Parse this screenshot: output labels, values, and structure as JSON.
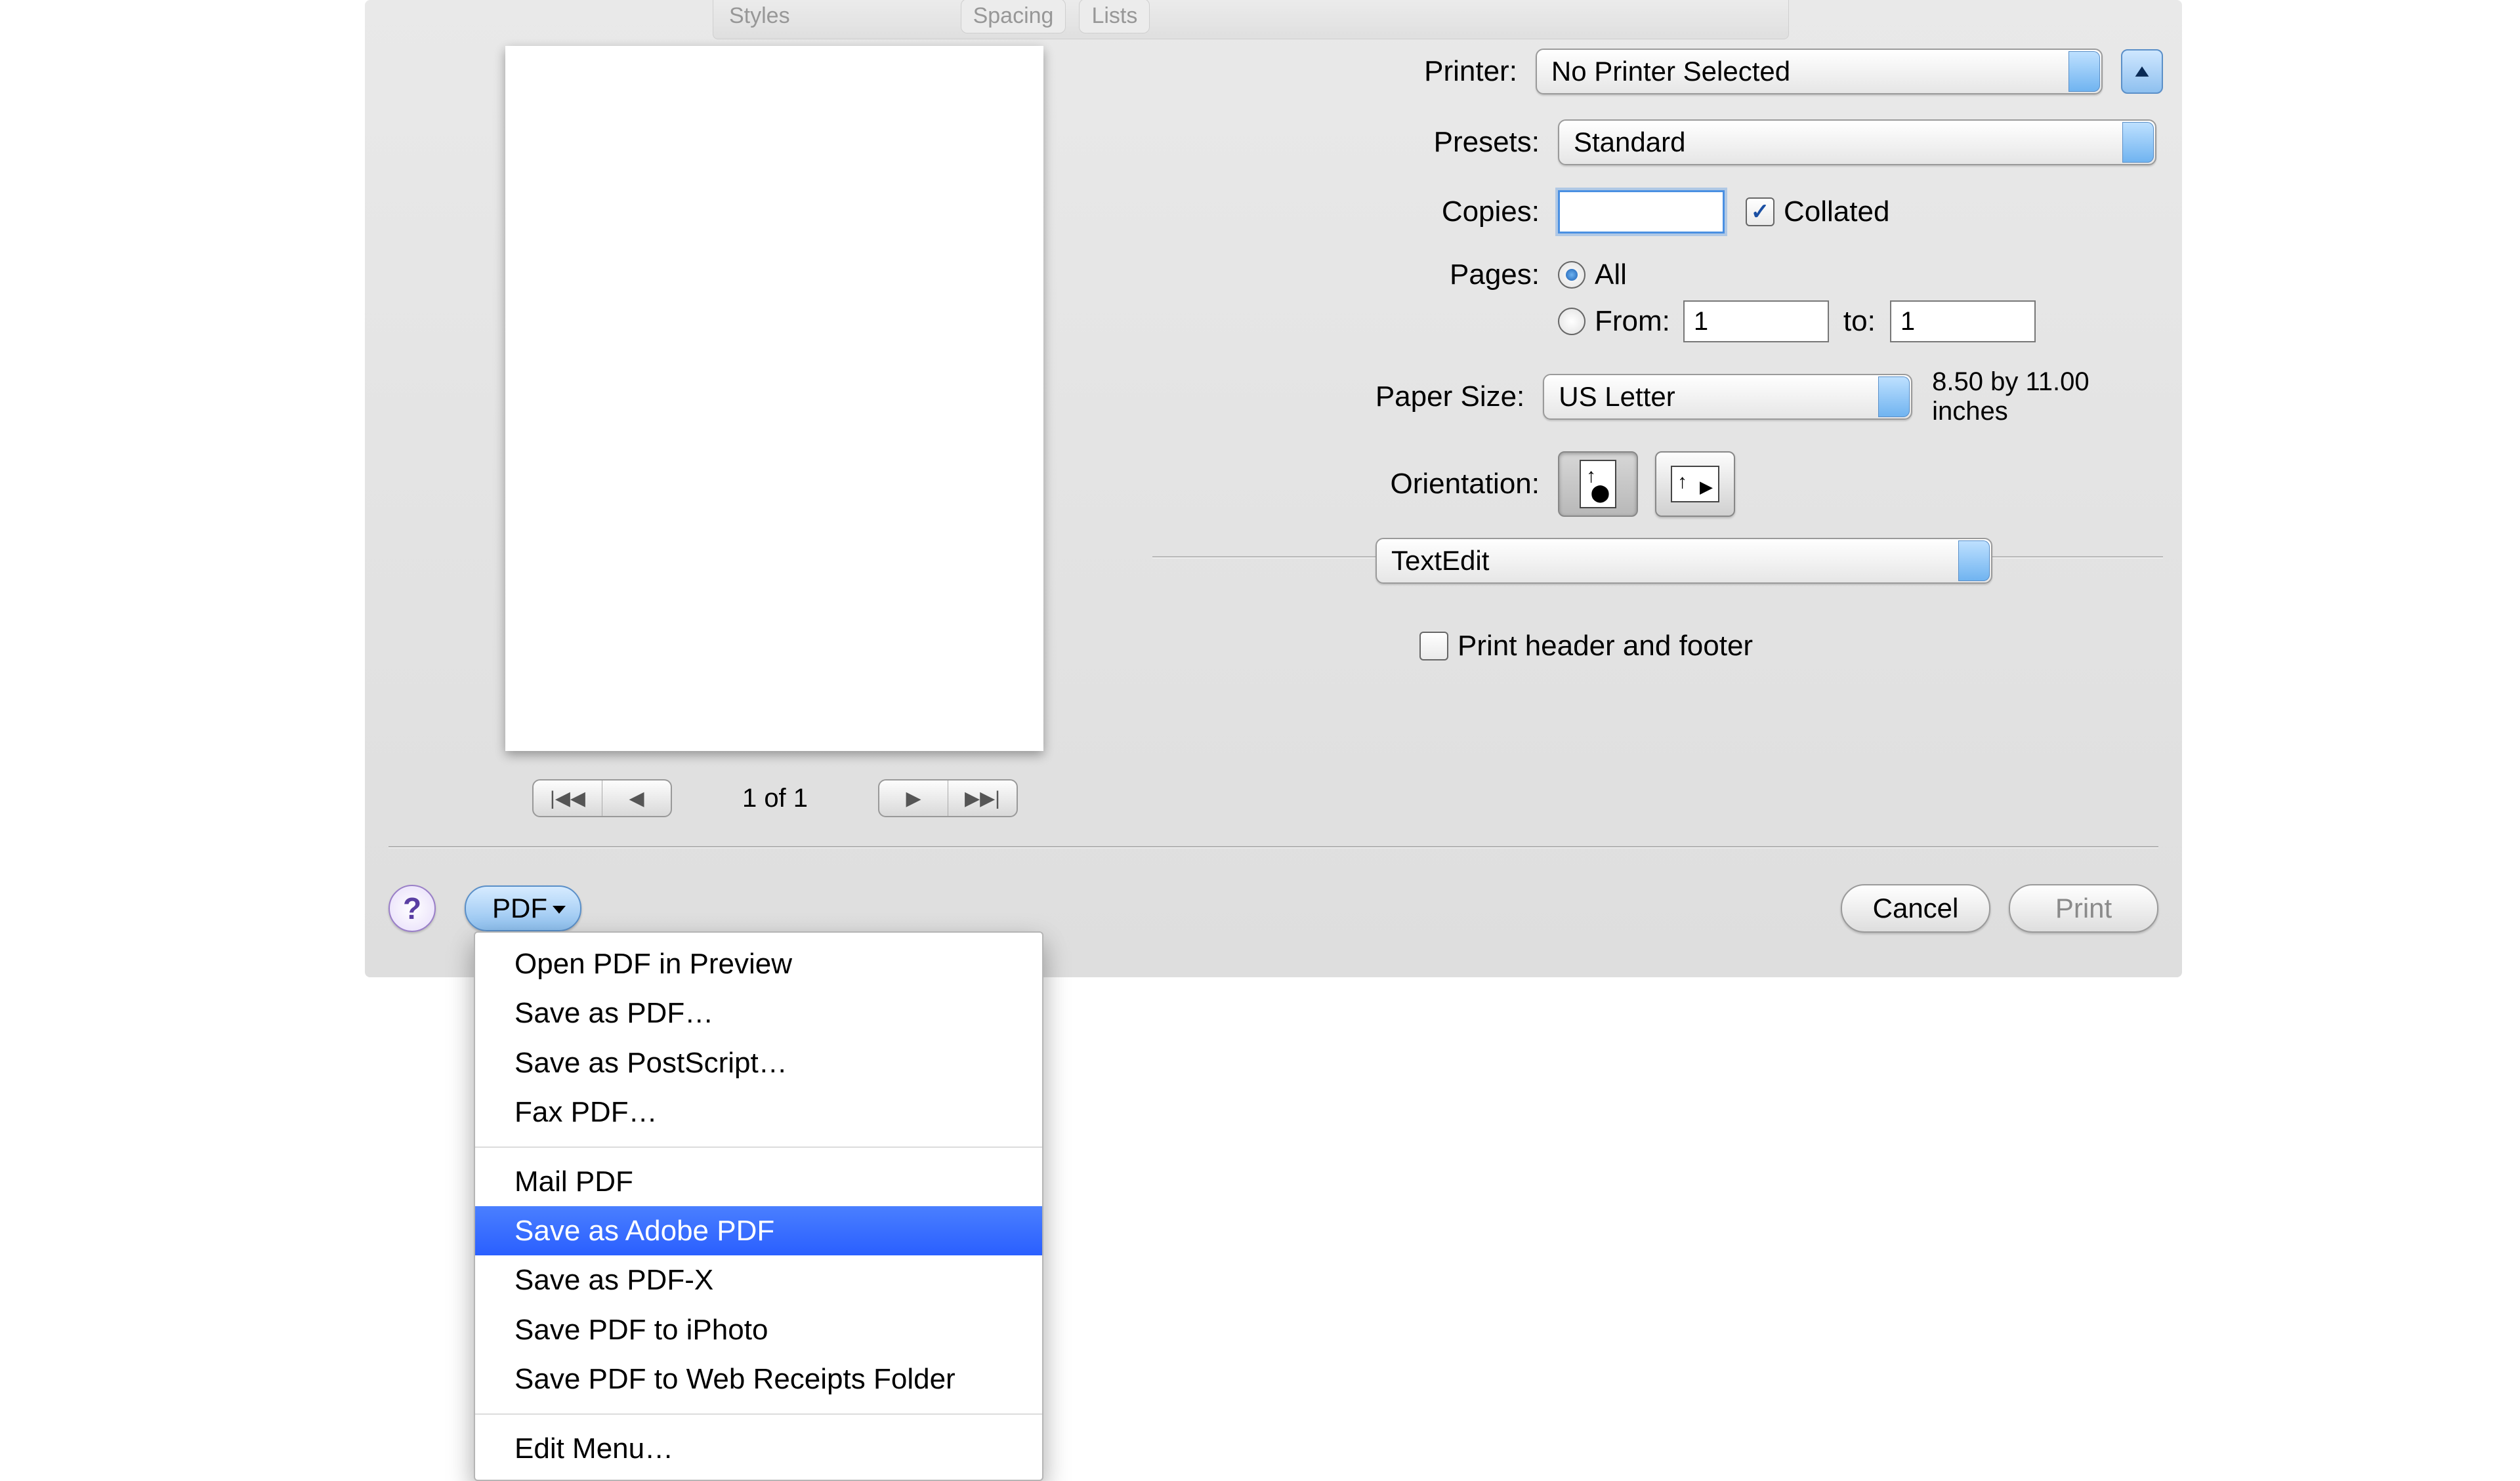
{
  "toolbar_ghost": {
    "styles": "Styles",
    "spacing": "Spacing",
    "lists": "Lists"
  },
  "labels": {
    "printer": "Printer:",
    "presets": "Presets:",
    "copies": "Copies:",
    "collated": "Collated",
    "pages": "Pages:",
    "all": "All",
    "from": "From:",
    "to": "to:",
    "paper_size": "Paper Size:",
    "orientation": "Orientation:",
    "header_footer": "Print header and footer"
  },
  "values": {
    "printer": "No Printer Selected",
    "preset": "Standard",
    "copies": "",
    "collated_checked": true,
    "pages_all_selected": true,
    "pages_from_selected": false,
    "from": "1",
    "to": "1",
    "paper_size": "US Letter",
    "paper_dims": "8.50 by 11.00 inches",
    "app_section": "TextEdit",
    "header_footer_checked": false
  },
  "pager": {
    "first": "|◀◀",
    "prev": "◀",
    "count": "1 of 1",
    "next": "▶",
    "last": "▶▶|"
  },
  "footer": {
    "help": "?",
    "pdf": "PDF",
    "cancel": "Cancel",
    "print": "Print"
  },
  "menu": {
    "group1": [
      "Open PDF in Preview",
      "Save as PDF…",
      "Save as PostScript…",
      "Fax PDF…"
    ],
    "group2": [
      "Mail PDF",
      "Save as Adobe PDF",
      "Save as PDF-X",
      "Save PDF to iPhoto",
      "Save PDF to Web Receipts Folder"
    ],
    "group3": [
      "Edit Menu…"
    ],
    "highlighted": "Save as Adobe PDF"
  }
}
